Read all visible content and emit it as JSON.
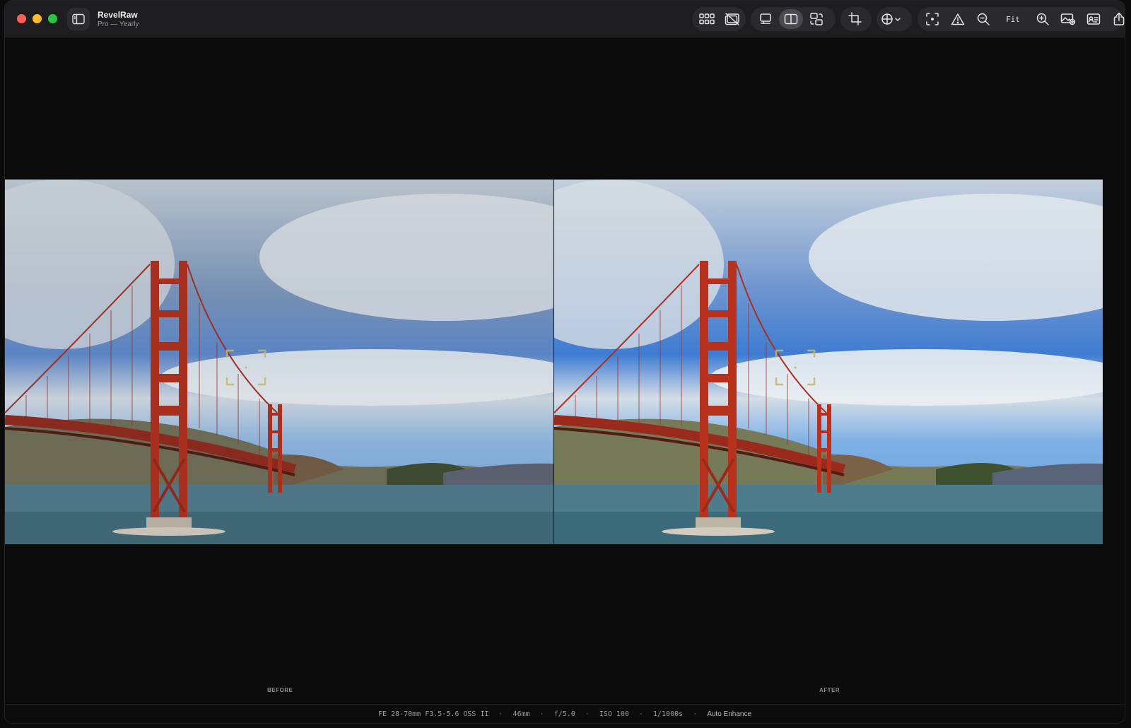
{
  "app": {
    "name": "RevelRaw",
    "plan": "Pro — Yearly"
  },
  "toolbar": {
    "groups": [
      [
        "grid-view-icon",
        "hide-photos-icon"
      ],
      [
        "single-view-icon",
        "split-view-icon",
        "swap-view-icon"
      ],
      [
        "crop-icon"
      ],
      [
        "overlay-menu-icon"
      ],
      [
        "focus-point-icon",
        "clipping-warning-icon",
        "zoom-out-icon",
        "fit",
        "zoom-in-icon",
        "add-photo-icon",
        "info-card-icon",
        "share-icon"
      ]
    ],
    "fit_label": "Fit",
    "active": "split-view-icon"
  },
  "viewer": {
    "before_label": "BEFORE",
    "after_label": "AFTER"
  },
  "status": {
    "lens": "FE 28-70mm F3.5-5.6 OSS II",
    "focal": "46mm",
    "aperture": "f/5.0",
    "iso": "ISO 100",
    "shutter": "1/1000s",
    "mode": "Auto Enhance"
  }
}
